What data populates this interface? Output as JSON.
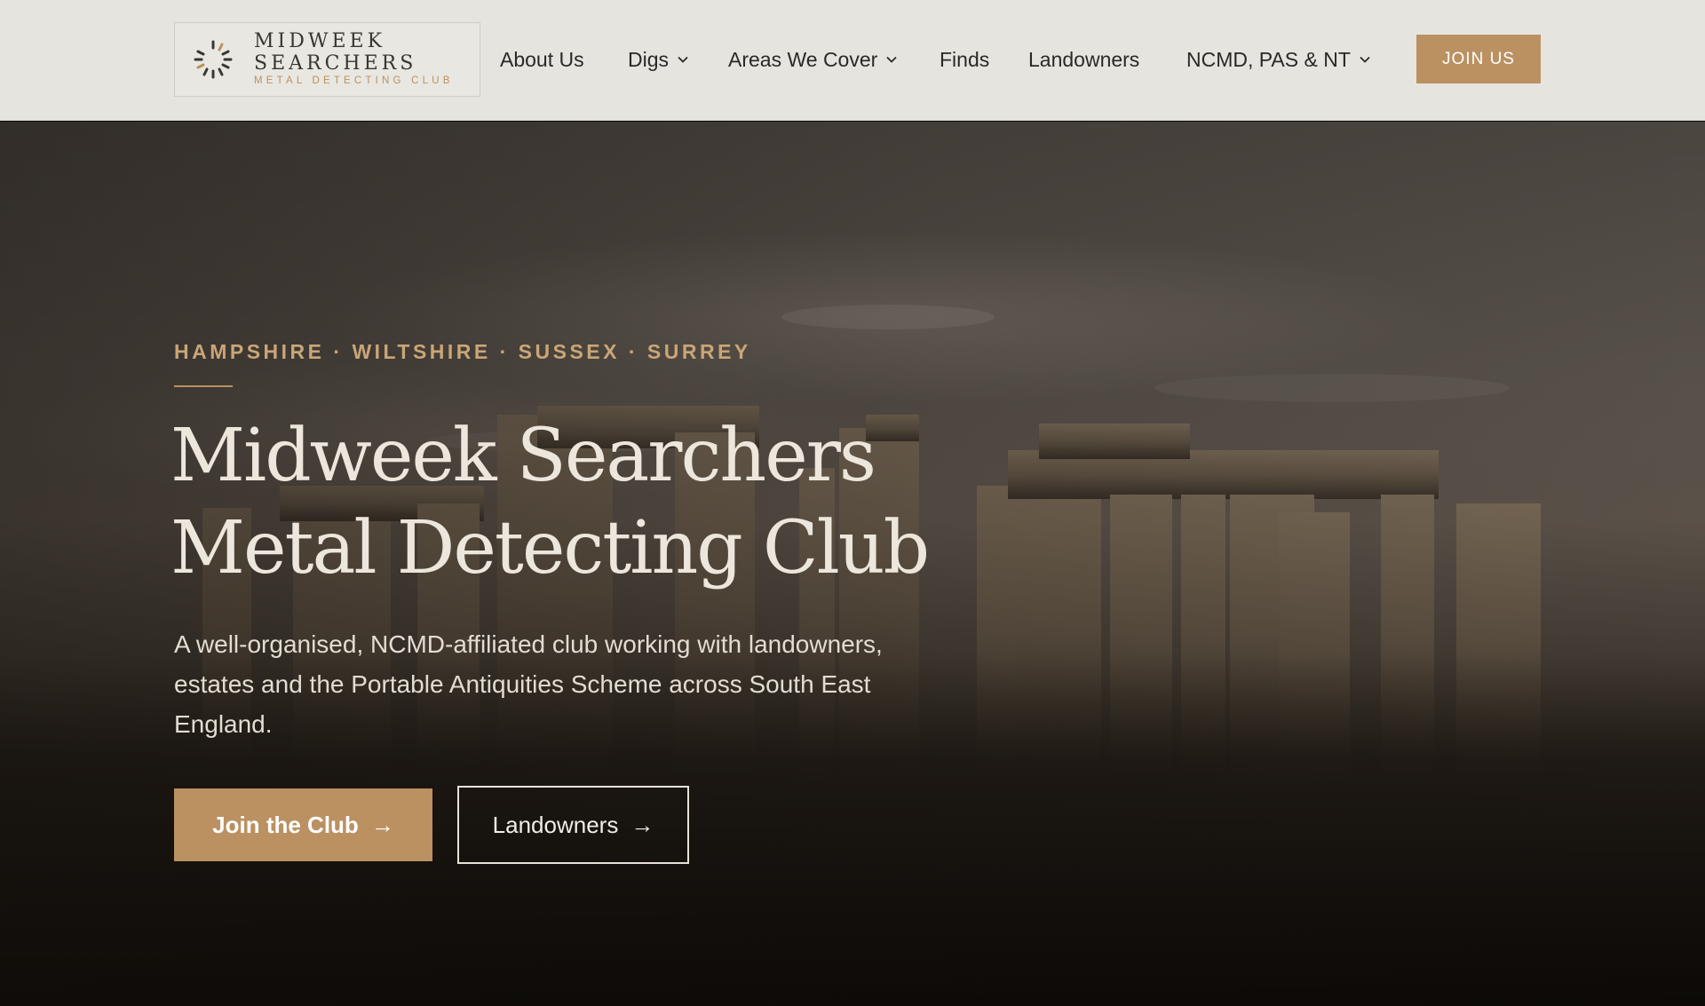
{
  "logo": {
    "line1": "MIDWEEK",
    "line2": "SEARCHERS",
    "sub": "METAL DETECTING CLUB"
  },
  "nav": {
    "items": [
      {
        "label": "About Us",
        "dropdown": false
      },
      {
        "label": "Digs",
        "dropdown": true
      },
      {
        "label": "Areas We Cover",
        "dropdown": true
      },
      {
        "label": "Finds",
        "dropdown": false
      },
      {
        "label": "Landowners",
        "dropdown": false
      },
      {
        "label": "NCMD, PAS & NT",
        "dropdown": true
      }
    ],
    "cta": "JOIN US"
  },
  "hero": {
    "eyebrow": "HAMPSHIRE · WILTSHIRE · SUSSEX · SURREY",
    "title_line1": "Midweek Searchers",
    "title_line2": "Metal Detecting Club",
    "lede": "A well-organised, NCMD-affiliated club working with landowners, estates and the Portable Antiquities Scheme across South East England.",
    "primary_button": "Join the Club",
    "secondary_button": "Landowners",
    "arrow": "→"
  },
  "colors": {
    "accent": "#bb9161",
    "header_bg": "#e6e4df",
    "eyebrow": "#c9a677",
    "headline": "#ece6dc"
  }
}
